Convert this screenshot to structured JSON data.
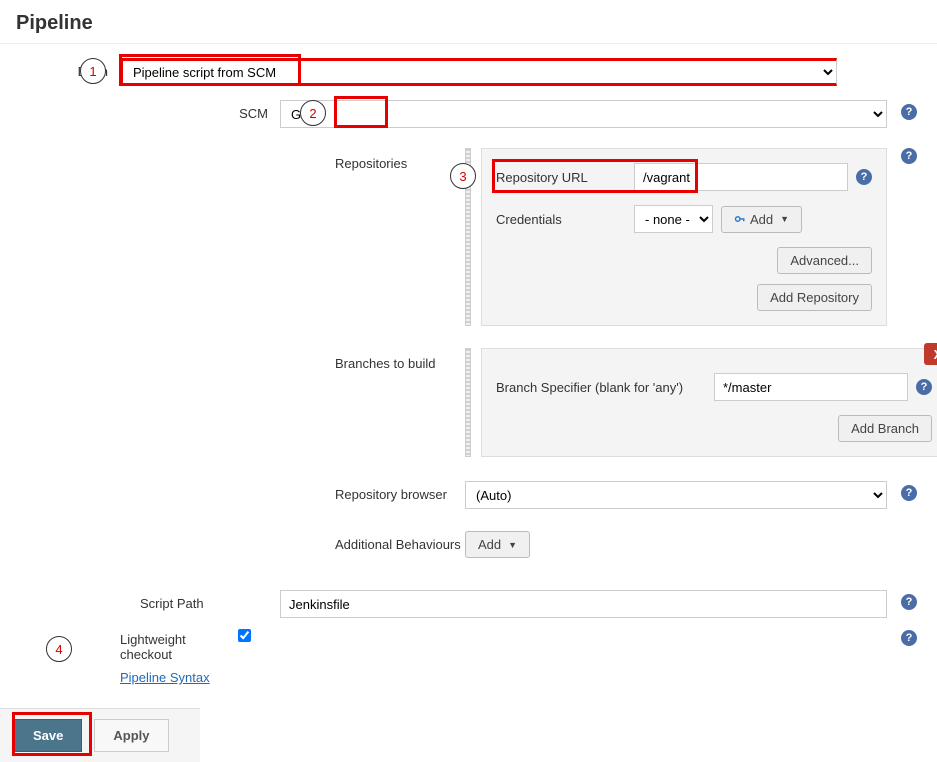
{
  "section_title": "Pipeline",
  "definition": {
    "label": "Definition",
    "value": "Pipeline script from SCM"
  },
  "scm": {
    "label": "SCM",
    "value": "Git"
  },
  "repositories": {
    "label": "Repositories",
    "url_label": "Repository URL",
    "url_value": "/vagrant",
    "credentials_label": "Credentials",
    "credentials_value": "- none -",
    "add_label": "Add",
    "advanced_label": "Advanced...",
    "add_repo_label": "Add Repository"
  },
  "branches": {
    "label": "Branches to build",
    "specifier_label": "Branch Specifier (blank for 'any')",
    "specifier_value": "*/master",
    "add_branch_label": "Add Branch",
    "delete_label": "X"
  },
  "repo_browser": {
    "label": "Repository browser",
    "value": "(Auto)"
  },
  "additional_behaviours": {
    "label": "Additional Behaviours",
    "add_label": "Add"
  },
  "script_path": {
    "label": "Script Path",
    "value": "Jenkinsfile"
  },
  "lightweight": {
    "label": "Lightweight checkout",
    "checked": true
  },
  "pipeline_syntax_link": "Pipeline Syntax",
  "footer": {
    "save": "Save",
    "apply": "Apply"
  },
  "callouts": {
    "c1": "1",
    "c2": "2",
    "c3": "3",
    "c4": "4"
  },
  "help_glyph": "?"
}
